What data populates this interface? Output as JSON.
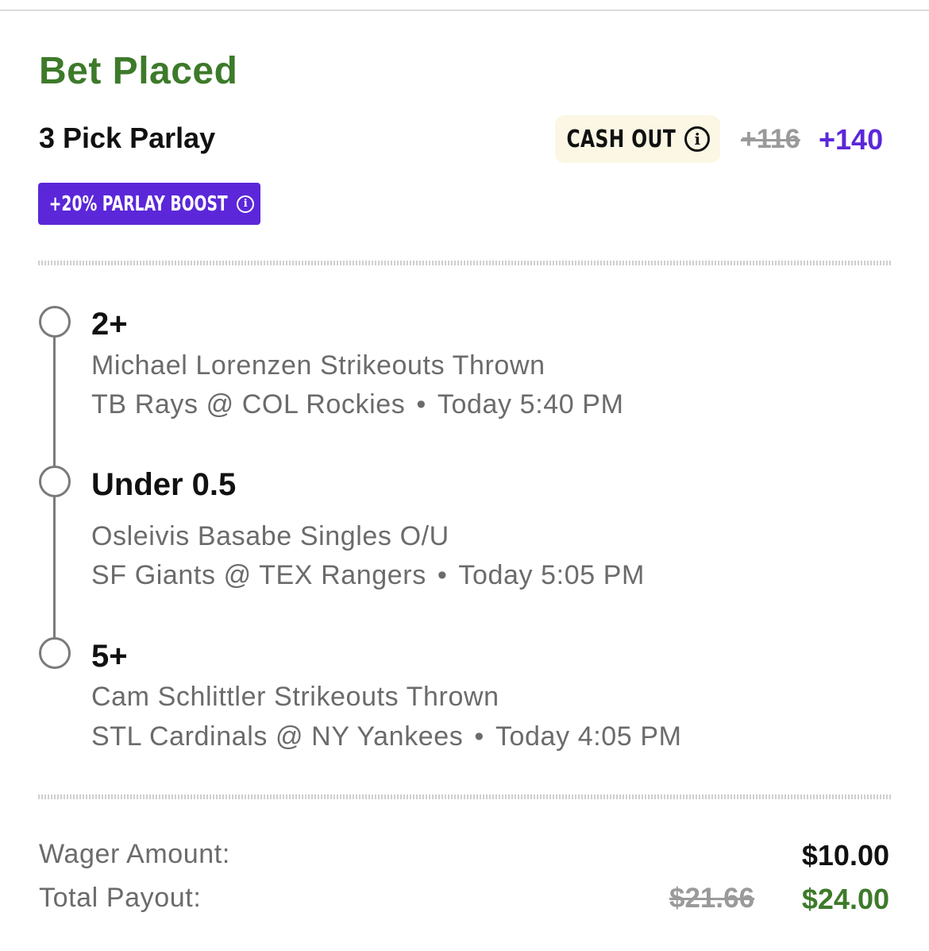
{
  "header": {
    "title": "Bet Placed",
    "parlay_type": "3 Pick Parlay",
    "cash_out_label": "CASH OUT",
    "odds_original": "+116",
    "odds_boosted": "+140",
    "boost_label": "+20% PARLAY BOOST"
  },
  "picks": [
    {
      "value": "2+",
      "market": "Michael Lorenzen Strikeouts Thrown",
      "matchup": "TB Rays @ COL Rockies",
      "separator": "•",
      "time": "Today 5:40 PM"
    },
    {
      "value": "Under 0.5",
      "market": "Osleivis Basabe Singles O/U",
      "matchup": "SF Giants @ TEX Rangers",
      "separator": "•",
      "time": "Today 5:05 PM"
    },
    {
      "value": "5+",
      "market": "Cam Schlittler Strikeouts Thrown",
      "matchup": "STL Cardinals @ NY Yankees",
      "separator": "•",
      "time": "Today 4:05 PM"
    }
  ],
  "summary": {
    "wager_label": "Wager Amount:",
    "wager_value": "$10.00",
    "payout_label": "Total Payout:",
    "payout_original": "$21.66",
    "payout_boosted": "$24.00"
  },
  "colors": {
    "title_green": "#3d7a2a",
    "boost_purple": "#5b27d9",
    "cashout_bg": "#fbf7e4",
    "muted_gray": "#6b6b6b"
  },
  "icons": {
    "cash_out_info": "info-icon",
    "boost_info": "info-icon"
  }
}
